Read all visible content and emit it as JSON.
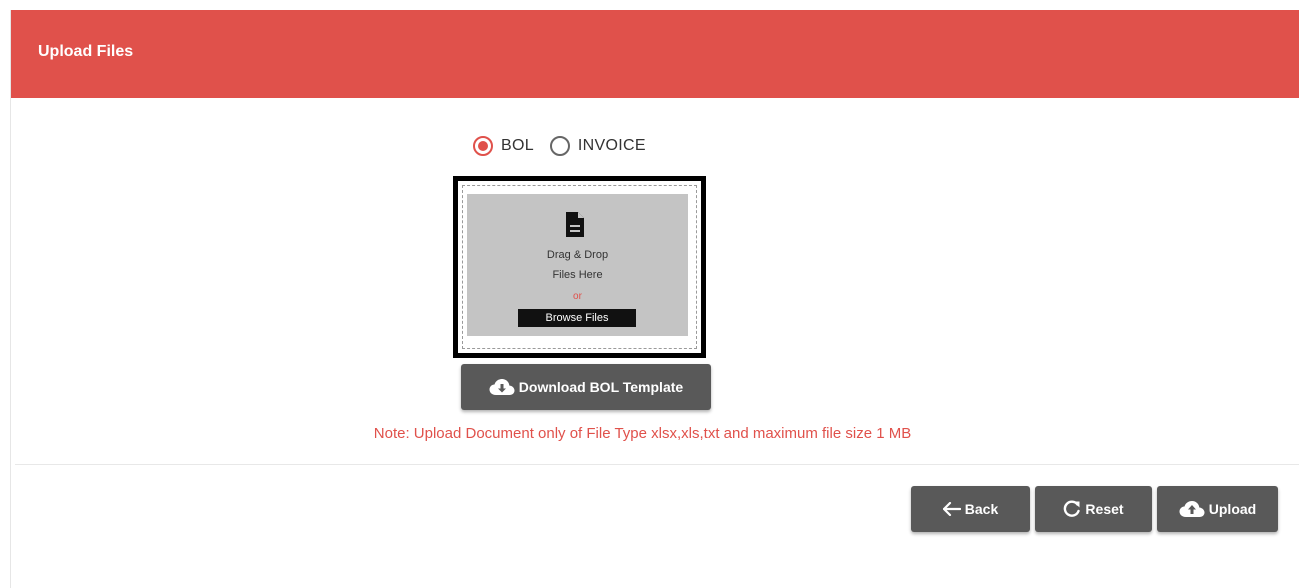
{
  "header": {
    "title": "Upload Files"
  },
  "file_type": {
    "options": [
      {
        "label": "BOL",
        "checked": true
      },
      {
        "label": "INVOICE",
        "checked": false
      }
    ]
  },
  "dropzone": {
    "icon": "file-text-icon",
    "line1": "Drag & Drop",
    "line2": "Files Here",
    "or": "or",
    "browse_label": "Browse Files"
  },
  "download_template": {
    "label": "Download BOL Template",
    "icon": "cloud-download-icon"
  },
  "note": "Note: Upload Document only of File Type xlsx,xls,txt and maximum file size 1 MB",
  "actions": {
    "back_label": "Back",
    "reset_label": "Reset",
    "upload_label": "Upload"
  },
  "colors": {
    "header_bg": "#e0514b",
    "accent": "#e0514b",
    "button_bg": "#595959",
    "dropzone_bg": "#c4c4c4"
  }
}
